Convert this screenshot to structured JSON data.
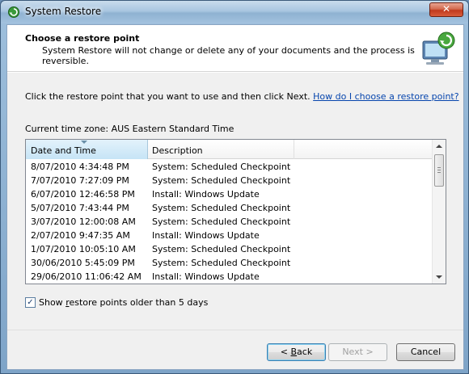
{
  "window": {
    "title": "System Restore",
    "close_glyph": "✕"
  },
  "header": {
    "title": "Choose a restore point",
    "subtitle": "System Restore will not change or delete any of your documents and the process is reversible."
  },
  "instructions": {
    "text": "Click the restore point that you want to use and then click Next.",
    "link": "How do I choose a restore point?"
  },
  "timezone": "Current time zone: AUS Eastern Standard Time",
  "list": {
    "columns": [
      "Date and Time",
      "Description"
    ],
    "rows": [
      {
        "date": "8/07/2010 4:34:48 PM",
        "desc": "System: Scheduled Checkpoint"
      },
      {
        "date": "7/07/2010 7:27:09 PM",
        "desc": "System: Scheduled Checkpoint"
      },
      {
        "date": "6/07/2010 12:46:58 PM",
        "desc": "Install: Windows Update"
      },
      {
        "date": "5/07/2010 7:43:44 PM",
        "desc": "System: Scheduled Checkpoint"
      },
      {
        "date": "3/07/2010 12:00:08 AM",
        "desc": "System: Scheduled Checkpoint"
      },
      {
        "date": "2/07/2010 9:47:35 AM",
        "desc": "Install: Windows Update"
      },
      {
        "date": "1/07/2010 10:05:10 AM",
        "desc": "System: Scheduled Checkpoint"
      },
      {
        "date": "30/06/2010 5:45:09 PM",
        "desc": "System: Scheduled Checkpoint"
      },
      {
        "date": "29/06/2010 11:06:42 AM",
        "desc": "Install: Windows Update"
      }
    ]
  },
  "show_older": {
    "checked": true,
    "label_pre": "Show ",
    "label_mnemonic": "r",
    "label_post": "estore points older than 5 days"
  },
  "buttons": {
    "back_pre": "< ",
    "back_mnemonic": "B",
    "back_post": "ack",
    "next": "Next >",
    "cancel": "Cancel"
  },
  "colors": {
    "link": "#0645ad",
    "sorted_column": "#c6e4f6"
  },
  "icons": {
    "title": "system-restore-icon",
    "header": "system-restore-computer-icon"
  }
}
